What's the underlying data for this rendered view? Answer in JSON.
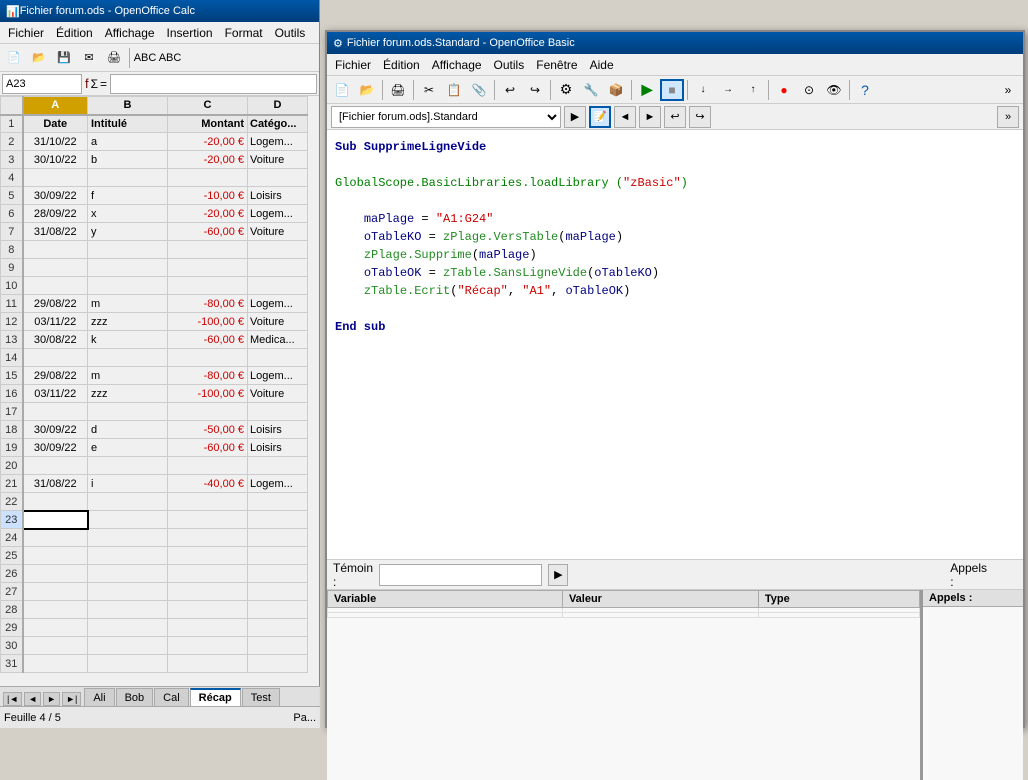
{
  "calc_window": {
    "title": "Fichier forum.ods - OpenOffice Calc",
    "menubar": [
      "Fichier",
      "Édition",
      "Affichage",
      "Insertion",
      "Format",
      "Outils"
    ],
    "name_box": "A23",
    "columns": [
      "A",
      "B",
      "C",
      "D"
    ],
    "col_headers": [
      "Date",
      "Intitulé",
      "Montant",
      "Catégorie"
    ],
    "rows": [
      {
        "num": 1,
        "a": "",
        "b": "",
        "c": "",
        "d": "",
        "is_header": true
      },
      {
        "num": 2,
        "a": "31/10/22",
        "b": "a",
        "c": "-20,00 €",
        "d": "Logem..."
      },
      {
        "num": 3,
        "a": "30/10/22",
        "b": "b",
        "c": "-20,00 €",
        "d": "Voiture"
      },
      {
        "num": 4,
        "a": "",
        "b": "",
        "c": "",
        "d": ""
      },
      {
        "num": 5,
        "a": "30/09/22",
        "b": "f",
        "c": "-10,00 €",
        "d": "Loisirs"
      },
      {
        "num": 6,
        "a": "28/09/22",
        "b": "x",
        "c": "-20,00 €",
        "d": "Logem..."
      },
      {
        "num": 7,
        "a": "31/08/22",
        "b": "y",
        "c": "-60,00 €",
        "d": "Voiture"
      },
      {
        "num": 8,
        "a": "",
        "b": "",
        "c": "",
        "d": ""
      },
      {
        "num": 9,
        "a": "",
        "b": "",
        "c": "",
        "d": ""
      },
      {
        "num": 10,
        "a": "",
        "b": "",
        "c": "",
        "d": ""
      },
      {
        "num": 11,
        "a": "29/08/22",
        "b": "m",
        "c": "-80,00 €",
        "d": "Logem..."
      },
      {
        "num": 12,
        "a": "03/11/22",
        "b": "zzz",
        "c": "-100,00 €",
        "d": "Voiture"
      },
      {
        "num": 13,
        "a": "30/08/22",
        "b": "k",
        "c": "-60,00 €",
        "d": "Medica..."
      },
      {
        "num": 14,
        "a": "",
        "b": "",
        "c": "",
        "d": ""
      },
      {
        "num": 15,
        "a": "29/08/22",
        "b": "m",
        "c": "-80,00 €",
        "d": "Logem..."
      },
      {
        "num": 16,
        "a": "03/11/22",
        "b": "zzz",
        "c": "-100,00 €",
        "d": "Voiture"
      },
      {
        "num": 17,
        "a": "",
        "b": "",
        "c": "",
        "d": ""
      },
      {
        "num": 18,
        "a": "30/09/22",
        "b": "d",
        "c": "-50,00 €",
        "d": "Loisirs"
      },
      {
        "num": 19,
        "a": "30/09/22",
        "b": "e",
        "c": "-60,00 €",
        "d": "Loisirs"
      },
      {
        "num": 20,
        "a": "",
        "b": "",
        "c": "",
        "d": ""
      },
      {
        "num": 21,
        "a": "31/08/22",
        "b": "i",
        "c": "-40,00 €",
        "d": "Logem..."
      },
      {
        "num": 22,
        "a": "",
        "b": "",
        "c": "",
        "d": ""
      },
      {
        "num": 23,
        "a": "",
        "b": "",
        "c": "",
        "d": "",
        "active": true
      },
      {
        "num": 24,
        "a": "",
        "b": "",
        "c": "",
        "d": ""
      },
      {
        "num": 25,
        "a": "",
        "b": "",
        "c": "",
        "d": ""
      },
      {
        "num": 26,
        "a": "",
        "b": "",
        "c": "",
        "d": ""
      },
      {
        "num": 27,
        "a": "",
        "b": "",
        "c": "",
        "d": ""
      },
      {
        "num": 28,
        "a": "",
        "b": "",
        "c": "",
        "d": ""
      },
      {
        "num": 29,
        "a": "",
        "b": "",
        "c": "",
        "d": ""
      },
      {
        "num": 30,
        "a": "",
        "b": "",
        "c": "",
        "d": ""
      },
      {
        "num": 31,
        "a": "",
        "b": "",
        "c": "",
        "d": ""
      }
    ],
    "tabs": [
      "Ali",
      "Bob",
      "Cal",
      "Récap",
      "Test"
    ],
    "active_tab": "Récap",
    "status": "Feuille 4 / 5",
    "status_right": "Pa..."
  },
  "basic_window": {
    "title": "Fichier forum.ods.Standard - OpenOffice Basic",
    "menubar": [
      "Fichier",
      "Édition",
      "Affichage",
      "Outils",
      "Fenêtre",
      "Aide"
    ],
    "module_selector": "[Fichier forum.ods].Standard",
    "code": [
      {
        "type": "keyword",
        "text": "Sub SupprimeLigneVide"
      },
      {
        "type": "empty"
      },
      {
        "type": "fn_call",
        "text": "GlobalScope.BasicLibraries.loadLibrary (\"zBasic\")"
      },
      {
        "type": "empty"
      },
      {
        "type": "indent",
        "text": "    maPlage = \"A1:G24\""
      },
      {
        "type": "indent",
        "text": "    oTableKO = zPlage.VersTable(maPlage)"
      },
      {
        "type": "indent",
        "text": "    zPlage.Supprime(maPlage)"
      },
      {
        "type": "indent",
        "text": "    oTableOK = zTable.SansLigneVide(oTableKO)"
      },
      {
        "type": "indent",
        "text": "    zTable.Ecrit(\"Récap\", \"A1\", oTableOK)"
      },
      {
        "type": "empty"
      },
      {
        "type": "keyword",
        "text": "End sub"
      }
    ],
    "witness_label": "Témoin :",
    "vars_columns": [
      "Variable",
      "Valeur",
      "Type"
    ],
    "calls_label": "Appels :"
  }
}
